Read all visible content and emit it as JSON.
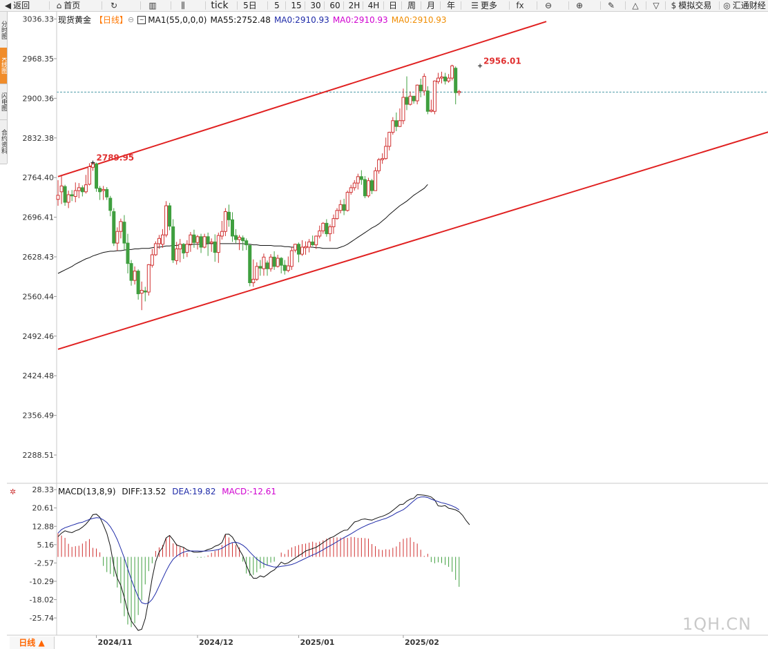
{
  "toolbar": {
    "items": [
      {
        "icon": "back-icon",
        "glyph": "◀",
        "label": "返回"
      },
      {
        "icon": "home-icon",
        "glyph": "⌂",
        "label": "首页"
      },
      {
        "icon": "refresh-icon",
        "glyph": "↻",
        "label": ""
      },
      {
        "icon": "bar-chart-icon",
        "glyph": "▥",
        "label": ""
      },
      {
        "icon": "candlestick-icon",
        "glyph": "⫼",
        "label": ""
      },
      {
        "icon": "",
        "glyph": "",
        "label": "tick"
      },
      {
        "icon": "",
        "glyph": "",
        "label": "5日"
      },
      {
        "icon": "",
        "glyph": "",
        "label": "5"
      },
      {
        "icon": "",
        "glyph": "",
        "label": "15"
      },
      {
        "icon": "",
        "glyph": "",
        "label": "30"
      },
      {
        "icon": "",
        "glyph": "",
        "label": "60"
      },
      {
        "icon": "",
        "glyph": "",
        "label": "2H"
      },
      {
        "icon": "",
        "glyph": "",
        "label": "4H"
      },
      {
        "icon": "",
        "glyph": "",
        "label": "日"
      },
      {
        "icon": "",
        "glyph": "",
        "label": "周"
      },
      {
        "icon": "",
        "glyph": "",
        "label": "月"
      },
      {
        "icon": "",
        "glyph": "",
        "label": "年"
      },
      {
        "icon": "menu-icon",
        "glyph": "☰",
        "label": "更多"
      },
      {
        "icon": "function-icon",
        "glyph": "fx",
        "label": ""
      },
      {
        "icon": "zoom-out-icon",
        "glyph": "⊖",
        "label": ""
      },
      {
        "icon": "zoom-in-icon",
        "glyph": "⊕",
        "label": ""
      },
      {
        "icon": "pen-icon",
        "glyph": "✎",
        "label": ""
      },
      {
        "icon": "triangle-up-icon",
        "glyph": "△",
        "label": ""
      },
      {
        "icon": "triangle-down-icon",
        "glyph": "▽",
        "label": ""
      },
      {
        "icon": "dollar-icon",
        "glyph": "$",
        "label": "模拟交易"
      },
      {
        "icon": "globe-icon",
        "glyph": "◎",
        "label": "汇通财经"
      }
    ]
  },
  "side_tabs": [
    "分时图",
    "K线图",
    "闪电图",
    "合约资料"
  ],
  "main_legend": {
    "name": "现货黄金",
    "period": "【日线】",
    "ma1": "MA1(55,0,0,0)",
    "ma55": "MA55:2752.48",
    "ma0_a": "MA0:2910.93",
    "ma0_b": "MA0:2910.93",
    "ma0_c": "MA0:2910.93"
  },
  "macd_legend": {
    "name": "MACD(13,8,9)",
    "diff": "DIFF:13.52",
    "dea": "DEA:19.82",
    "macd": "MACD:-12.61"
  },
  "bottom_tab": "日线 ▲",
  "watermark": "1QH.CN",
  "colors": {
    "up": "#d03030",
    "down": "#3f9f3f",
    "channel": "#e02020",
    "ma": "#111111",
    "diff": "#111111",
    "dea": "#1e2aa8",
    "macd_label": "#d000d0",
    "period": "#ff7700",
    "price_label": "#e03030"
  },
  "chart_data": {
    "type": "candlestick",
    "title": "现货黄金",
    "price_axis": {
      "ticks": [
        "3036.33",
        "2968.35",
        "2900.36",
        "2832.38",
        "2764.40",
        "2696.41",
        "2628.43",
        "2560.44",
        "2492.46",
        "2424.48",
        "2356.49",
        "2288.51"
      ],
      "range": [
        2240,
        3050
      ]
    },
    "macd_axis": {
      "ticks": [
        "28.33",
        "20.61",
        "12.88",
        "5.16",
        "-2.57",
        "-10.29",
        "-18.02",
        "-25.74"
      ],
      "range": [
        -33,
        31
      ]
    },
    "x_labels": [
      {
        "label": "2024/11",
        "index": 11
      },
      {
        "label": "2024/12",
        "index": 40
      },
      {
        "label": "2025/01",
        "index": 69
      },
      {
        "label": "2025/02",
        "index": 99
      }
    ],
    "last_price": 2910.93,
    "annotations": [
      {
        "text": "2789.95",
        "index": 10,
        "price": 2789.95
      },
      {
        "text": "2956.01",
        "index": 121,
        "price": 2956.01
      }
    ],
    "channel_lines": [
      {
        "from": {
          "index": 0,
          "price": 2766
        },
        "to": {
          "index": 140,
          "price": 3032
        }
      },
      {
        "from": {
          "index": 0,
          "price": 2470
        },
        "to": {
          "index": 205,
          "price": 2845
        }
      }
    ],
    "candles": [
      [
        2727,
        2734,
        2716,
        2760
      ],
      [
        2740,
        2750,
        2719,
        2769
      ],
      [
        2749,
        2722,
        2716,
        2752
      ],
      [
        2722,
        2735,
        2712,
        2742
      ],
      [
        2735,
        2733,
        2724,
        2743
      ],
      [
        2732,
        2742,
        2722,
        2756
      ],
      [
        2742,
        2747,
        2729,
        2755
      ],
      [
        2747,
        2740,
        2732,
        2751
      ],
      [
        2740,
        2752,
        2737,
        2769
      ],
      [
        2753,
        2783,
        2751,
        2789
      ],
      [
        2782,
        2789,
        2776,
        2789.95
      ],
      [
        2788,
        2746,
        2740,
        2790
      ],
      [
        2746,
        2740,
        2726,
        2750
      ],
      [
        2742,
        2744,
        2726,
        2750
      ],
      [
        2744,
        2731,
        2726,
        2748
      ],
      [
        2729,
        2708,
        2698,
        2733
      ],
      [
        2706,
        2652,
        2647,
        2712
      ],
      [
        2652,
        2672,
        2639,
        2679
      ],
      [
        2672,
        2689,
        2660,
        2694
      ],
      [
        2688,
        2652,
        2640,
        2700
      ],
      [
        2652,
        2617,
        2600,
        2668
      ],
      [
        2617,
        2588,
        2579,
        2623
      ],
      [
        2588,
        2604,
        2581,
        2612
      ],
      [
        2604,
        2565,
        2555,
        2607
      ],
      [
        2566,
        2571,
        2537,
        2586
      ],
      [
        2570,
        2568,
        2552,
        2577
      ],
      [
        2568,
        2615,
        2562,
        2616
      ],
      [
        2614,
        2632,
        2610,
        2642
      ],
      [
        2632,
        2651,
        2630,
        2655
      ],
      [
        2651,
        2660,
        2642,
        2666
      ],
      [
        2650,
        2666,
        2644,
        2676
      ],
      [
        2666,
        2716,
        2662,
        2724
      ],
      [
        2716,
        2681,
        2674,
        2721
      ],
      [
        2680,
        2623,
        2618,
        2693
      ],
      [
        2622,
        2642,
        2615,
        2654
      ],
      [
        2642,
        2650,
        2619,
        2659
      ],
      [
        2650,
        2635,
        2625,
        2652
      ],
      [
        2636,
        2650,
        2628,
        2657
      ],
      [
        2650,
        2666,
        2637,
        2671
      ],
      [
        2666,
        2653,
        2644,
        2675
      ],
      [
        2653,
        2663,
        2641,
        2666
      ],
      [
        2663,
        2645,
        2635,
        2668
      ],
      [
        2645,
        2663,
        2643,
        2668
      ],
      [
        2663,
        2652,
        2630,
        2670
      ],
      [
        2652,
        2654,
        2637,
        2660
      ],
      [
        2654,
        2636,
        2620,
        2667
      ],
      [
        2636,
        2665,
        2618,
        2670
      ],
      [
        2664,
        2672,
        2658,
        2690
      ],
      [
        2672,
        2706,
        2664,
        2712
      ],
      [
        2705,
        2692,
        2680,
        2718
      ],
      [
        2692,
        2664,
        2654,
        2705
      ],
      [
        2665,
        2658,
        2652,
        2676
      ],
      [
        2658,
        2662,
        2640,
        2666
      ],
      [
        2661,
        2656,
        2639,
        2665
      ],
      [
        2656,
        2649,
        2640,
        2660
      ],
      [
        2648,
        2584,
        2578,
        2649
      ],
      [
        2584,
        2590,
        2577,
        2624
      ],
      [
        2590,
        2612,
        2587,
        2619
      ],
      [
        2612,
        2609,
        2596,
        2623
      ],
      [
        2608,
        2628,
        2596,
        2634
      ],
      [
        2618,
        2608,
        2596,
        2622
      ],
      [
        2608,
        2628,
        2603,
        2633
      ],
      [
        2628,
        2612,
        2606,
        2638
      ],
      [
        2612,
        2626,
        2610,
        2632
      ],
      [
        2626,
        2614,
        2600,
        2628
      ],
      [
        2614,
        2605,
        2598,
        2623
      ],
      [
        2605,
        2613,
        2602,
        2629
      ],
      [
        2612,
        2639,
        2606,
        2645
      ],
      [
        2640,
        2650,
        2636,
        2651
      ],
      [
        2650,
        2633,
        2619,
        2653
      ],
      [
        2633,
        2645,
        2630,
        2657
      ],
      [
        2644,
        2646,
        2632,
        2655
      ],
      [
        2645,
        2654,
        2636,
        2659
      ],
      [
        2654,
        2649,
        2647,
        2665
      ],
      [
        2649,
        2664,
        2642,
        2665
      ],
      [
        2664,
        2673,
        2660,
        2682
      ],
      [
        2673,
        2686,
        2668,
        2688
      ],
      [
        2686,
        2668,
        2663,
        2693
      ],
      [
        2668,
        2680,
        2655,
        2684
      ],
      [
        2680,
        2694,
        2668,
        2701
      ],
      [
        2694,
        2708,
        2692,
        2712
      ],
      [
        2708,
        2718,
        2703,
        2726
      ],
      [
        2718,
        2708,
        2700,
        2728
      ],
      [
        2708,
        2739,
        2706,
        2742
      ],
      [
        2739,
        2747,
        2735,
        2752
      ],
      [
        2747,
        2755,
        2742,
        2760
      ],
      [
        2755,
        2766,
        2744,
        2771
      ],
      [
        2766,
        2761,
        2752,
        2777
      ],
      [
        2761,
        2733,
        2729,
        2767
      ],
      [
        2733,
        2759,
        2730,
        2764
      ],
      [
        2759,
        2742,
        2736,
        2762
      ],
      [
        2742,
        2776,
        2742,
        2782
      ],
      [
        2776,
        2795,
        2771,
        2798
      ],
      [
        2795,
        2797,
        2788,
        2806
      ],
      [
        2797,
        2818,
        2795,
        2833
      ],
      [
        2818,
        2842,
        2811,
        2843
      ],
      [
        2842,
        2862,
        2838,
        2868
      ],
      [
        2862,
        2852,
        2844,
        2876
      ],
      [
        2852,
        2862,
        2851,
        2883
      ],
      [
        2862,
        2902,
        2856,
        2917
      ],
      [
        2902,
        2890,
        2880,
        2938
      ],
      [
        2890,
        2904,
        2888,
        2912
      ],
      [
        2904,
        2896,
        2891,
        2903
      ],
      [
        2896,
        2923,
        2890,
        2924
      ],
      [
        2923,
        2913,
        2902,
        2934
      ],
      [
        2913,
        2938,
        2905,
        2943
      ],
      [
        2913,
        2878,
        2873,
        2921
      ],
      [
        2878,
        2880,
        2876,
        2898
      ],
      [
        2878,
        2930,
        2873,
        2931
      ],
      [
        2929,
        2935,
        2925,
        2944
      ],
      [
        2935,
        2937,
        2926,
        2946
      ],
      [
        2937,
        2930,
        2924,
        2944
      ],
      [
        2930,
        2935,
        2927,
        2942
      ],
      [
        2935,
        2956.01,
        2931,
        2958
      ],
      [
        2952,
        2910,
        2890,
        2955
      ],
      [
        2910,
        2912,
        2905,
        2915
      ]
    ],
    "ma55": [
      2600,
      2603,
      2606,
      2609,
      2612,
      2616,
      2619,
      2622,
      2625,
      2627,
      2630,
      2632,
      2634,
      2636,
      2637,
      2638,
      2638,
      2639,
      2639,
      2640,
      2641,
      2641,
      2642,
      2642,
      2643,
      2643,
      2643,
      2644,
      2645,
      2645,
      2646,
      2647,
      2647,
      2648,
      2648,
      2649,
      2649,
      2649,
      2649,
      2650,
      2650,
      2650,
      2650,
      2651,
      2651,
      2651,
      2651,
      2651,
      2651,
      2651,
      2651,
      2651,
      2651,
      2651,
      2650,
      2650,
      2649,
      2649,
      2648,
      2648,
      2648,
      2648,
      2647,
      2647,
      2647,
      2646,
      2646,
      2645,
      2645,
      2645,
      2645,
      2645,
      2645,
      2645,
      2644,
      2644,
      2643,
      2643,
      2643,
      2643,
      2643,
      2645,
      2647,
      2650,
      2654,
      2658,
      2662,
      2666,
      2670,
      2674,
      2678,
      2681,
      2685,
      2690,
      2695,
      2701,
      2706,
      2711,
      2716,
      2720,
      2724,
      2729,
      2734,
      2738,
      2742,
      2746,
      2752.48
    ],
    "ma55_start": 0,
    "diff": [
      8.5,
      10,
      11,
      10.5,
      10.2,
      11,
      11.5,
      12.5,
      13.8,
      15.5,
      17.8,
      18,
      16.7,
      13.5,
      9.9,
      4.4,
      -3.8,
      -9,
      -12,
      -17,
      -23,
      -27,
      -29,
      -31,
      -30.5,
      -26,
      -18,
      -9,
      -2,
      2,
      4,
      8,
      9,
      7.2,
      5,
      4.5,
      4,
      3,
      2.5,
      2,
      2,
      2.1,
      2.5,
      3.1,
      3.5,
      4.5,
      5,
      6,
      9.5,
      9.6,
      8.3,
      5.8,
      3,
      0.5,
      -3.5,
      -7,
      -9,
      -9,
      -8,
      -8.5,
      -7.5,
      -6.3,
      -5.5,
      -4,
      -2.2,
      -3,
      -2.5,
      -1.5,
      -0.5,
      0.5,
      1.4,
      2.5,
      3,
      3.5,
      4,
      5,
      6,
      7,
      8,
      8.5,
      9.5,
      10.4,
      11.2,
      11.3,
      13,
      14.7,
      15.1,
      15.8,
      16,
      15.7,
      15.5,
      16.1,
      16.7,
      17.1,
      17.7,
      18.5,
      19.6,
      20.8,
      22,
      22.2,
      23.5,
      24.3,
      24.7,
      26.2,
      26.1,
      26,
      25.7,
      25.2,
      24,
      21.5,
      21.3,
      21.6,
      20.5,
      20.2,
      19.8,
      19,
      17.5,
      15.3,
      13.52
    ],
    "dea": [
      10,
      11.5,
      12.3,
      12.8,
      13.3,
      13.8,
      14.3,
      14.6,
      15.2,
      15.8,
      16.2,
      16.5,
      16.4,
      15.6,
      14.5,
      12.7,
      10.3,
      7.3,
      3.5,
      -0.4,
      -5,
      -9.5,
      -13.3,
      -16.9,
      -19.3,
      -19.8,
      -19.4,
      -17.9,
      -15.4,
      -12.3,
      -9.1,
      -6,
      -3.2,
      -1,
      0.3,
      1.3,
      2,
      2.4,
      2.5,
      2.5,
      2.5,
      2.4,
      2.4,
      2.5,
      2.6,
      2.8,
      3.1,
      3.6,
      4.6,
      5.4,
      6,
      6.2,
      5.7,
      4.9,
      3.7,
      2,
      0.5,
      -0.9,
      -2,
      -2.9,
      -3.5,
      -3.9,
      -4.3,
      -4.3,
      -4,
      -3.8,
      -3.5,
      -3.2,
      -2.7,
      -2,
      -1.3,
      -0.6,
      0.1,
      0.8,
      1.4,
      2.2,
      3,
      3.9,
      4.7,
      5.5,
      6.4,
      7.3,
      8.1,
      8.9,
      9.7,
      10.6,
      11.5,
      12.3,
      13,
      13.7,
      14.2,
      14.8,
      15.3,
      15.8,
      16.2,
      16.9,
      17.6,
      18.5,
      19.2,
      19.9,
      21,
      22.3,
      23.6,
      24.8,
      25.2,
      25.3,
      25,
      24.3,
      23.8,
      23.3,
      22.8,
      22.5,
      22,
      21.5,
      20.8,
      19.82
    ],
    "macd": [
      10,
      9,
      8,
      5.5,
      4.2,
      4.5,
      4.7,
      5.6,
      6.6,
      7.5,
      3.8,
      3.5,
      1.9,
      -3.8,
      -6.4,
      -7.2,
      -8.3,
      -12.9,
      -19.5,
      -25,
      -28.5,
      -29.6,
      -28,
      -24.5,
      -18.3,
      -11.6,
      -6,
      -2.7,
      2.5,
      4,
      5,
      8,
      9,
      5.7,
      5.5,
      4.2,
      4,
      1.6,
      0,
      0,
      -0.3,
      -0.4,
      -0.2,
      0.6,
      1.7,
      2.5,
      3,
      5,
      9.6,
      8.2,
      5.8,
      5,
      4,
      -2,
      -7,
      -8,
      -7.6,
      -6.5,
      -5,
      -4.6,
      -3.6,
      -2.4,
      -2,
      0,
      1.8,
      1.2,
      3,
      4,
      4.5,
      5,
      5.4,
      5.6,
      6,
      6.4,
      6,
      6.4,
      7,
      7.7,
      8,
      8.1,
      8.2,
      8.1,
      8,
      8,
      8.4,
      8.3,
      8,
      8,
      7.9,
      7.7,
      5.4,
      4.5,
      3.2,
      2.9,
      3.2,
      3.1,
      3.8,
      4.4,
      6.3,
      7.6,
      7.9,
      8.2,
      6.3,
      5.6,
      3,
      0.4,
      1.3,
      -2.2,
      -2.7,
      -2.3,
      -2.6,
      -3.4,
      -4.2,
      -6.3,
      -9.7,
      -12.61
    ]
  }
}
